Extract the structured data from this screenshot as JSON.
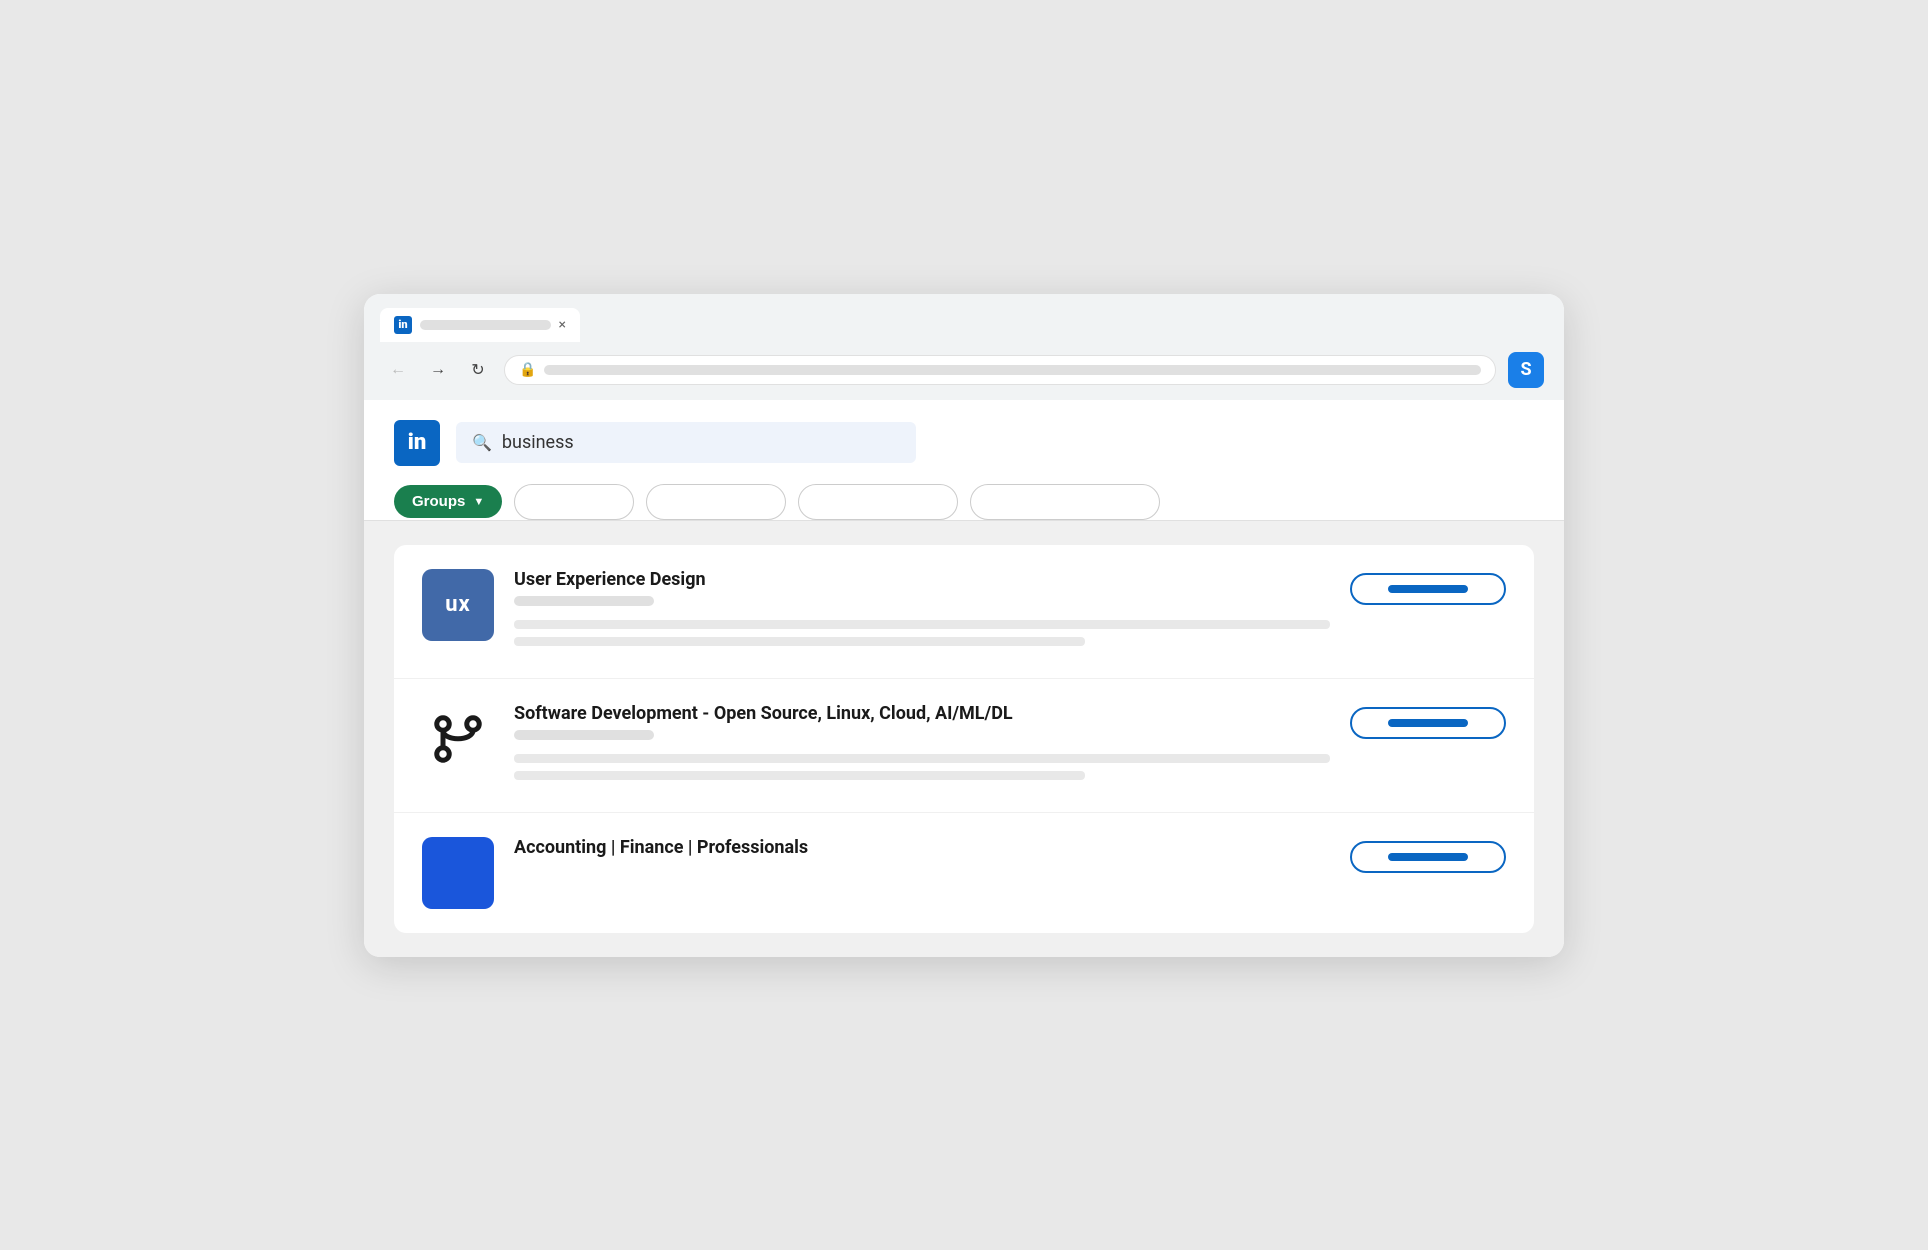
{
  "browser": {
    "tab": {
      "favicon_label": "in",
      "title_placeholder": true,
      "close_label": "×"
    },
    "nav": {
      "back_icon": "←",
      "forward_icon": "→",
      "reload_icon": "↻"
    },
    "extension_icon": "S"
  },
  "linkedin": {
    "logo_label": "in",
    "search": {
      "icon": "🔍",
      "value": "business"
    },
    "filters": {
      "active_label": "Groups",
      "active_arrow": "▼",
      "pills": [
        "",
        "",
        "",
        ""
      ]
    }
  },
  "results": [
    {
      "id": "ux",
      "logo_text": "ux",
      "title": "User  Experience Design",
      "has_subtitle": true,
      "has_desc": true
    },
    {
      "id": "software",
      "logo_type": "git",
      "title": "Software Development - Open Source, Linux, Cloud, AI/ML/DL",
      "has_subtitle": true,
      "has_desc": true
    },
    {
      "id": "accounting",
      "logo_type": "solid_blue",
      "title": "Accounting | Finance | Professionals",
      "has_subtitle": false,
      "has_desc": false
    }
  ]
}
